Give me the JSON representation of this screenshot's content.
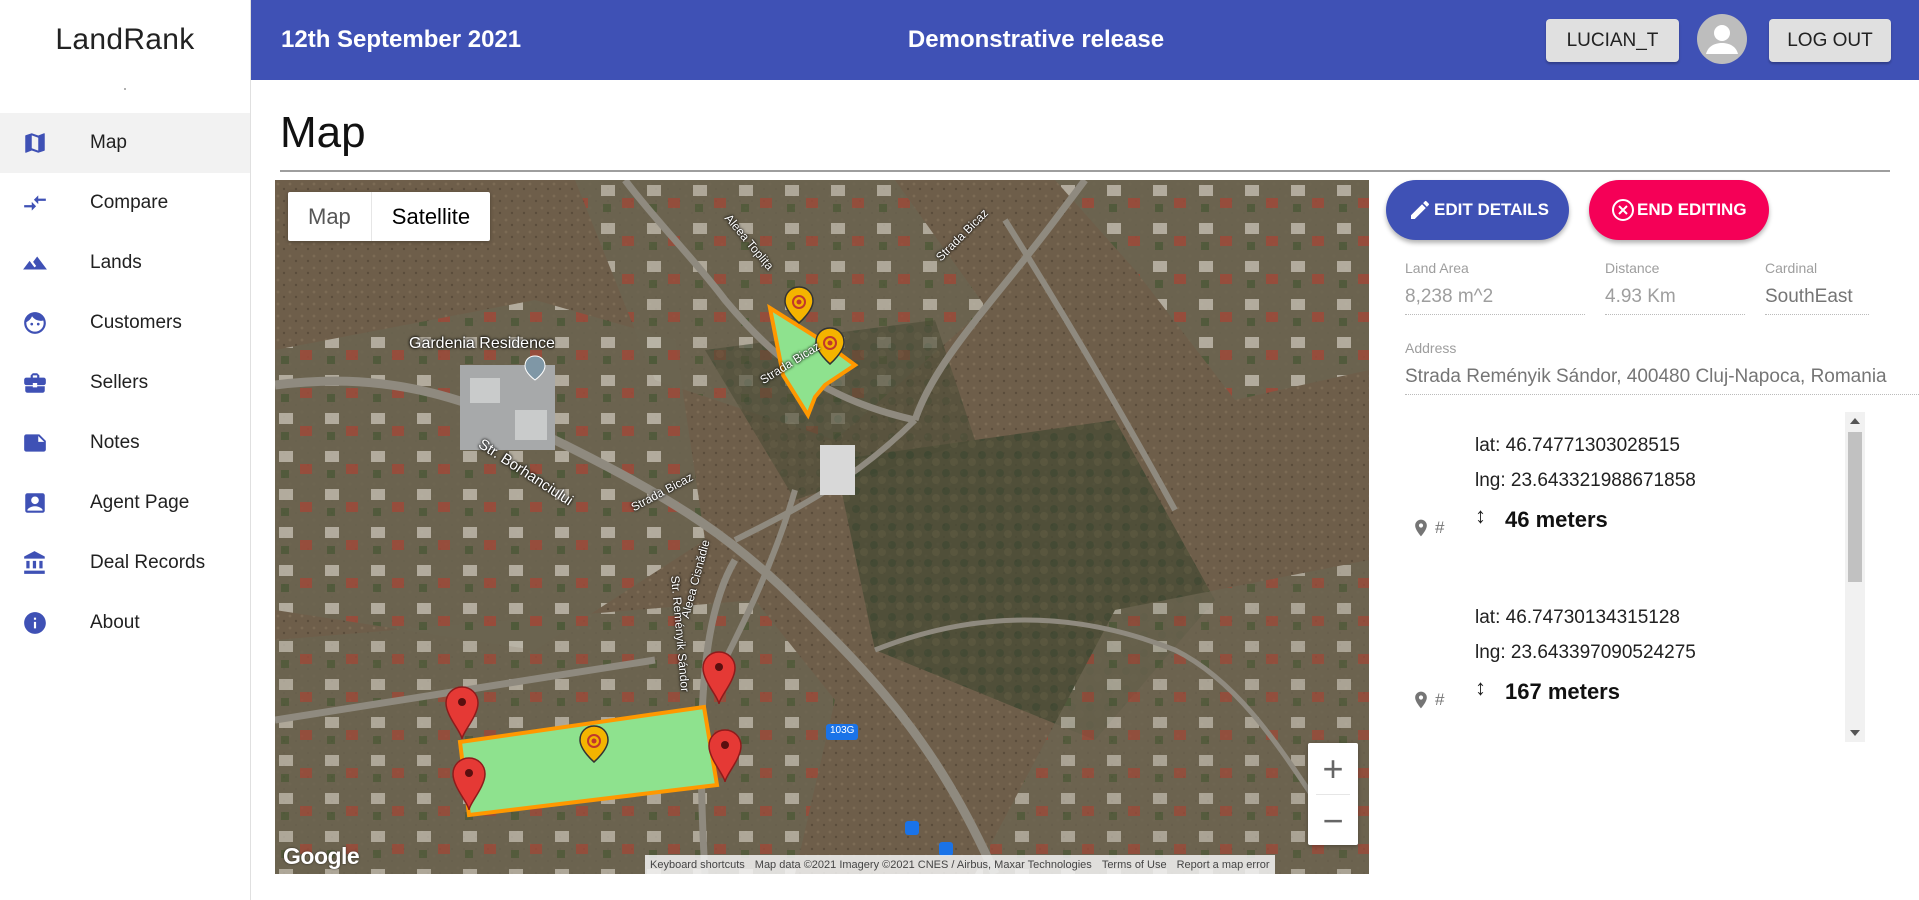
{
  "app": {
    "name": "LandRank"
  },
  "sidebar": {
    "items": [
      {
        "label": "Map",
        "icon": "map-icon",
        "active": true
      },
      {
        "label": "Compare",
        "icon": "compare-arrows-icon"
      },
      {
        "label": "Lands",
        "icon": "terrain-icon"
      },
      {
        "label": "Customers",
        "icon": "face-icon"
      },
      {
        "label": "Sellers",
        "icon": "briefcase-icon"
      },
      {
        "label": "Notes",
        "icon": "note-icon"
      },
      {
        "label": "Agent Page",
        "icon": "badge-icon"
      },
      {
        "label": "Deal Records",
        "icon": "bank-icon"
      },
      {
        "label": "About",
        "icon": "info-icon"
      }
    ]
  },
  "header": {
    "date": "12th September 2021",
    "release": "Demonstrative release",
    "user": "LUCIAN_T",
    "logout": "LOG OUT",
    "accent_color": "#3f51b5"
  },
  "page": {
    "title": "Map"
  },
  "map": {
    "type_options": [
      "Map",
      "Satellite"
    ],
    "selected_type": "Satellite",
    "labels": {
      "gardenia": "Gardenia Residence",
      "borhanciului": "Str. Borhanciului",
      "bicaz1": "Strada Bicaz",
      "bicaz2": "Strada Bicaz",
      "bicaz3": "Strada Bicaz",
      "toplita": "Aleea Toplița",
      "cisnadie": "Aleea Cisnădie",
      "remenyik": "Str. Reményik Sándor",
      "road": "103G"
    },
    "zoom_in": "+",
    "zoom_out": "−",
    "google": "Google",
    "attribution": {
      "shortcuts": "Keyboard shortcuts",
      "data": "Map data ©2021 Imagery ©2021 CNES / Airbus, Maxar Technologies",
      "terms": "Terms of Use",
      "report": "Report a map error"
    },
    "polygon_color": "#8ee28e",
    "polygon_border": "#ff9800",
    "marker_color": "#e53935"
  },
  "actions": {
    "edit": "EDIT DETAILS",
    "end": "END EDITING",
    "edit_color": "#3f51b5",
    "end_color": "#f50057"
  },
  "details": {
    "land_area": {
      "label": "Land Area",
      "value": "8,238 m^2"
    },
    "distance": {
      "label": "Distance",
      "value": "4.93 Km"
    },
    "cardinal": {
      "label": "Cardinal",
      "value": "SouthEast"
    },
    "address": {
      "label": "Address",
      "value": "Strada Reményik Sándor, 400480 Cluj-Napoca, Romania"
    }
  },
  "coordinates": [
    {
      "hash": "#",
      "lat": "lat: 46.74771303028515",
      "lng": "lng: 23.643321988671858",
      "arrow": "↕",
      "distance": "46 meters"
    },
    {
      "hash": "#",
      "lat": "lat: 46.74730134315128",
      "lng": "lng: 23.643397090524275",
      "arrow": "↕",
      "distance": "167 meters"
    }
  ]
}
